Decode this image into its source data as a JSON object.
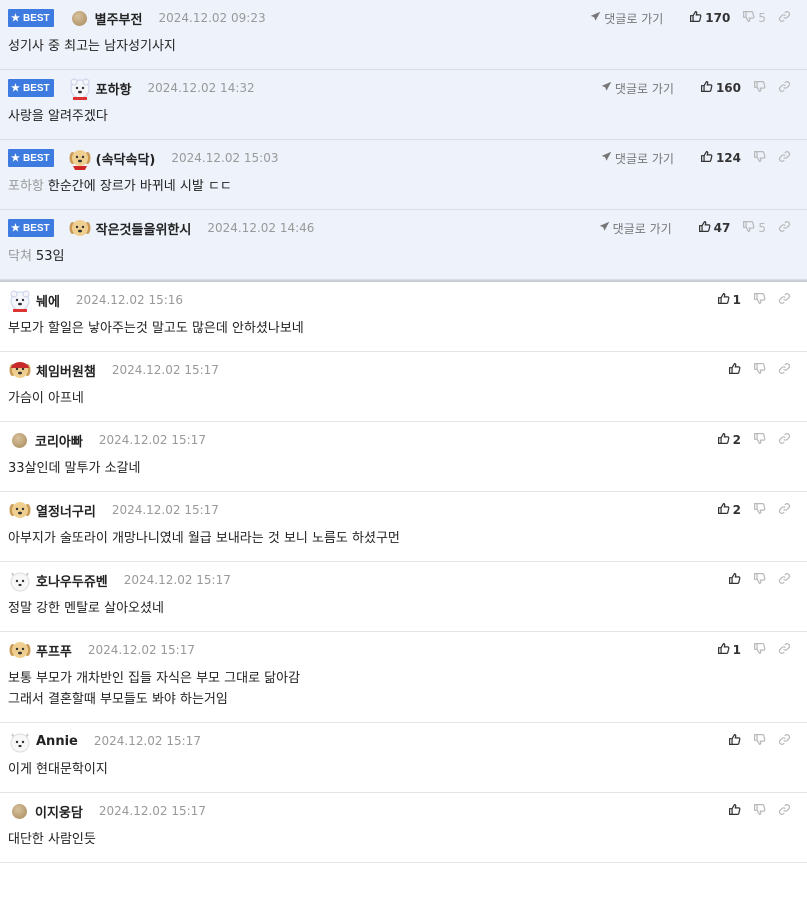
{
  "labels": {
    "best": "BEST",
    "reply": "댓글로 가기"
  },
  "colors": {
    "best_bg": "#edf2fb",
    "badge": "#3d7be0"
  },
  "best_comments": [
    {
      "nick": "별주부전",
      "time": "2024.12.02 09:23",
      "text": "성기사 중 최고는 남자성기사지",
      "mention": "",
      "likes": "170",
      "dislikes": "5",
      "avatar": "dot"
    },
    {
      "nick": "포하항",
      "time": "2024.12.02 14:32",
      "text": "사랑을 알려주겠다",
      "mention": "",
      "likes": "160",
      "dislikes": "",
      "avatar": "polar"
    },
    {
      "nick": "(속닥속닥)",
      "time": "2024.12.02 15:03",
      "text": "한순간에 장르가 바뀌네 시발 ㄷㄷ",
      "mention": "포하항",
      "likes": "124",
      "dislikes": "",
      "avatar": "dog-red"
    },
    {
      "nick": "작은것들을위한시",
      "time": "2024.12.02 14:46",
      "text": "53임",
      "mention": "닥쳐",
      "likes": "47",
      "dislikes": "5",
      "avatar": "dog"
    }
  ],
  "comments": [
    {
      "nick": "눼에",
      "time": "2024.12.02 15:16",
      "text": "부모가 할일은 낳아주는것 말고도 많은데 안하셨나보네",
      "text2": "",
      "likes": "1",
      "avatar": "polar"
    },
    {
      "nick": "체임버원챔",
      "time": "2024.12.02 15:17",
      "text": "가슴이 아프네",
      "text2": "",
      "likes": "",
      "avatar": "dog-hat"
    },
    {
      "nick": "코리아빠",
      "time": "2024.12.02 15:17",
      "text": "33살인데 말투가 소갈네",
      "text2": "",
      "likes": "2",
      "avatar": "dot"
    },
    {
      "nick": "열정너구리",
      "time": "2024.12.02 15:17",
      "text": "아부지가 술또라이 개망나니였네 월급 보내라는 것 보니 노름도 하셨구먼",
      "text2": "",
      "likes": "2",
      "avatar": "dog"
    },
    {
      "nick": "호나우두쥬벤",
      "time": "2024.12.02 15:17",
      "text": "정말 강한 멘탈로 살아오셨네",
      "text2": "",
      "likes": "",
      "avatar": "white"
    },
    {
      "nick": "푸프푸",
      "time": "2024.12.02 15:17",
      "text": "보통 부모가 개차반인 집들 자식은 부모 그대로 닮아감",
      "text2": "그래서 결혼할때 부모들도 봐야 하는거임",
      "likes": "1",
      "avatar": "dog"
    },
    {
      "nick": "Annie",
      "time": "2024.12.02 15:17",
      "text": "이게 현대문학이지",
      "text2": "",
      "likes": "",
      "avatar": "white"
    },
    {
      "nick": "이지웅담",
      "time": "2024.12.02 15:17",
      "text": "대단한 사람인듯",
      "text2": "",
      "likes": "",
      "avatar": "dot"
    }
  ]
}
